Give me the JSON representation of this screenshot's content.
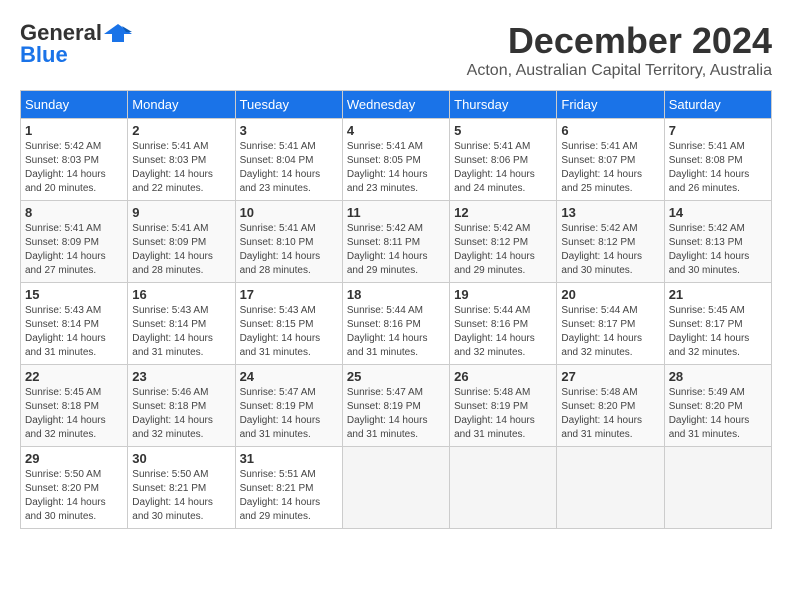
{
  "header": {
    "logo_general": "General",
    "logo_blue": "Blue",
    "month_year": "December 2024",
    "location": "Acton, Australian Capital Territory, Australia"
  },
  "weekdays": [
    "Sunday",
    "Monday",
    "Tuesday",
    "Wednesday",
    "Thursday",
    "Friday",
    "Saturday"
  ],
  "weeks": [
    [
      {
        "day": "1",
        "sunrise": "Sunrise: 5:42 AM",
        "sunset": "Sunset: 8:03 PM",
        "daylight": "Daylight: 14 hours and 20 minutes."
      },
      {
        "day": "2",
        "sunrise": "Sunrise: 5:41 AM",
        "sunset": "Sunset: 8:03 PM",
        "daylight": "Daylight: 14 hours and 22 minutes."
      },
      {
        "day": "3",
        "sunrise": "Sunrise: 5:41 AM",
        "sunset": "Sunset: 8:04 PM",
        "daylight": "Daylight: 14 hours and 23 minutes."
      },
      {
        "day": "4",
        "sunrise": "Sunrise: 5:41 AM",
        "sunset": "Sunset: 8:05 PM",
        "daylight": "Daylight: 14 hours and 23 minutes."
      },
      {
        "day": "5",
        "sunrise": "Sunrise: 5:41 AM",
        "sunset": "Sunset: 8:06 PM",
        "daylight": "Daylight: 14 hours and 24 minutes."
      },
      {
        "day": "6",
        "sunrise": "Sunrise: 5:41 AM",
        "sunset": "Sunset: 8:07 PM",
        "daylight": "Daylight: 14 hours and 25 minutes."
      },
      {
        "day": "7",
        "sunrise": "Sunrise: 5:41 AM",
        "sunset": "Sunset: 8:08 PM",
        "daylight": "Daylight: 14 hours and 26 minutes."
      }
    ],
    [
      {
        "day": "8",
        "sunrise": "Sunrise: 5:41 AM",
        "sunset": "Sunset: 8:09 PM",
        "daylight": "Daylight: 14 hours and 27 minutes."
      },
      {
        "day": "9",
        "sunrise": "Sunrise: 5:41 AM",
        "sunset": "Sunset: 8:09 PM",
        "daylight": "Daylight: 14 hours and 28 minutes."
      },
      {
        "day": "10",
        "sunrise": "Sunrise: 5:41 AM",
        "sunset": "Sunset: 8:10 PM",
        "daylight": "Daylight: 14 hours and 28 minutes."
      },
      {
        "day": "11",
        "sunrise": "Sunrise: 5:42 AM",
        "sunset": "Sunset: 8:11 PM",
        "daylight": "Daylight: 14 hours and 29 minutes."
      },
      {
        "day": "12",
        "sunrise": "Sunrise: 5:42 AM",
        "sunset": "Sunset: 8:12 PM",
        "daylight": "Daylight: 14 hours and 29 minutes."
      },
      {
        "day": "13",
        "sunrise": "Sunrise: 5:42 AM",
        "sunset": "Sunset: 8:12 PM",
        "daylight": "Daylight: 14 hours and 30 minutes."
      },
      {
        "day": "14",
        "sunrise": "Sunrise: 5:42 AM",
        "sunset": "Sunset: 8:13 PM",
        "daylight": "Daylight: 14 hours and 30 minutes."
      }
    ],
    [
      {
        "day": "15",
        "sunrise": "Sunrise: 5:43 AM",
        "sunset": "Sunset: 8:14 PM",
        "daylight": "Daylight: 14 hours and 31 minutes."
      },
      {
        "day": "16",
        "sunrise": "Sunrise: 5:43 AM",
        "sunset": "Sunset: 8:14 PM",
        "daylight": "Daylight: 14 hours and 31 minutes."
      },
      {
        "day": "17",
        "sunrise": "Sunrise: 5:43 AM",
        "sunset": "Sunset: 8:15 PM",
        "daylight": "Daylight: 14 hours and 31 minutes."
      },
      {
        "day": "18",
        "sunrise": "Sunrise: 5:44 AM",
        "sunset": "Sunset: 8:16 PM",
        "daylight": "Daylight: 14 hours and 31 minutes."
      },
      {
        "day": "19",
        "sunrise": "Sunrise: 5:44 AM",
        "sunset": "Sunset: 8:16 PM",
        "daylight": "Daylight: 14 hours and 32 minutes."
      },
      {
        "day": "20",
        "sunrise": "Sunrise: 5:44 AM",
        "sunset": "Sunset: 8:17 PM",
        "daylight": "Daylight: 14 hours and 32 minutes."
      },
      {
        "day": "21",
        "sunrise": "Sunrise: 5:45 AM",
        "sunset": "Sunset: 8:17 PM",
        "daylight": "Daylight: 14 hours and 32 minutes."
      }
    ],
    [
      {
        "day": "22",
        "sunrise": "Sunrise: 5:45 AM",
        "sunset": "Sunset: 8:18 PM",
        "daylight": "Daylight: 14 hours and 32 minutes."
      },
      {
        "day": "23",
        "sunrise": "Sunrise: 5:46 AM",
        "sunset": "Sunset: 8:18 PM",
        "daylight": "Daylight: 14 hours and 32 minutes."
      },
      {
        "day": "24",
        "sunrise": "Sunrise: 5:47 AM",
        "sunset": "Sunset: 8:19 PM",
        "daylight": "Daylight: 14 hours and 31 minutes."
      },
      {
        "day": "25",
        "sunrise": "Sunrise: 5:47 AM",
        "sunset": "Sunset: 8:19 PM",
        "daylight": "Daylight: 14 hours and 31 minutes."
      },
      {
        "day": "26",
        "sunrise": "Sunrise: 5:48 AM",
        "sunset": "Sunset: 8:19 PM",
        "daylight": "Daylight: 14 hours and 31 minutes."
      },
      {
        "day": "27",
        "sunrise": "Sunrise: 5:48 AM",
        "sunset": "Sunset: 8:20 PM",
        "daylight": "Daylight: 14 hours and 31 minutes."
      },
      {
        "day": "28",
        "sunrise": "Sunrise: 5:49 AM",
        "sunset": "Sunset: 8:20 PM",
        "daylight": "Daylight: 14 hours and 31 minutes."
      }
    ],
    [
      {
        "day": "29",
        "sunrise": "Sunrise: 5:50 AM",
        "sunset": "Sunset: 8:20 PM",
        "daylight": "Daylight: 14 hours and 30 minutes."
      },
      {
        "day": "30",
        "sunrise": "Sunrise: 5:50 AM",
        "sunset": "Sunset: 8:21 PM",
        "daylight": "Daylight: 14 hours and 30 minutes."
      },
      {
        "day": "31",
        "sunrise": "Sunrise: 5:51 AM",
        "sunset": "Sunset: 8:21 PM",
        "daylight": "Daylight: 14 hours and 29 minutes."
      },
      null,
      null,
      null,
      null
    ]
  ]
}
